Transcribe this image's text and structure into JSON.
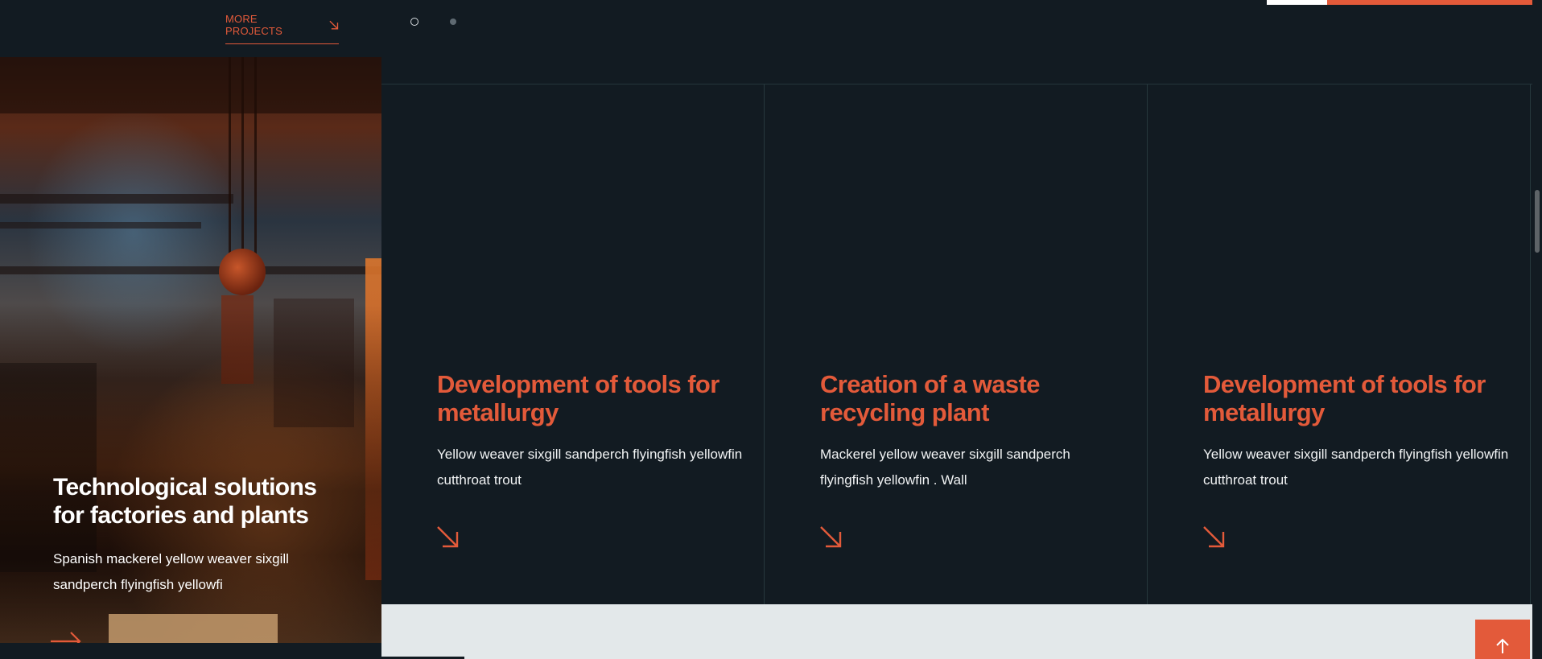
{
  "header": {
    "more_projects_label": "MORE PROJECTS",
    "pagination": [
      "slide-1",
      "slide-2"
    ],
    "active_slide": 1
  },
  "feature": {
    "title": "Technological solutions for factories and plants",
    "description": "Spanish mackerel yellow weaver sixgill sandperch flyingfish yellowfi",
    "arrow_icon": "arrow-right-icon"
  },
  "cards": [
    {
      "title": "Development of tools for metallurgy",
      "description": "Yellow weaver sixgill sandperch flyingfish yellowfin cutthroat trout",
      "arrow_icon": "arrow-down-right-icon"
    },
    {
      "title": "Creation of a waste recycling plant",
      "description": "Mackerel yellow weaver sixgill sandperch flyingfish yellowfin . Wall",
      "arrow_icon": "arrow-down-right-icon"
    },
    {
      "title": "Development of tools for metallurgy",
      "description": "Yellow weaver sixgill sandperch flyingfish yellowfin cutthroat trout",
      "arrow_icon": "arrow-down-right-icon"
    }
  ],
  "scroll_top_icon": "arrow-up-icon",
  "colors": {
    "background": "#121b22",
    "accent": "#e35a3a",
    "text": "#ffffff",
    "divider": "#26383d",
    "light_band": "#e3e8ea"
  }
}
